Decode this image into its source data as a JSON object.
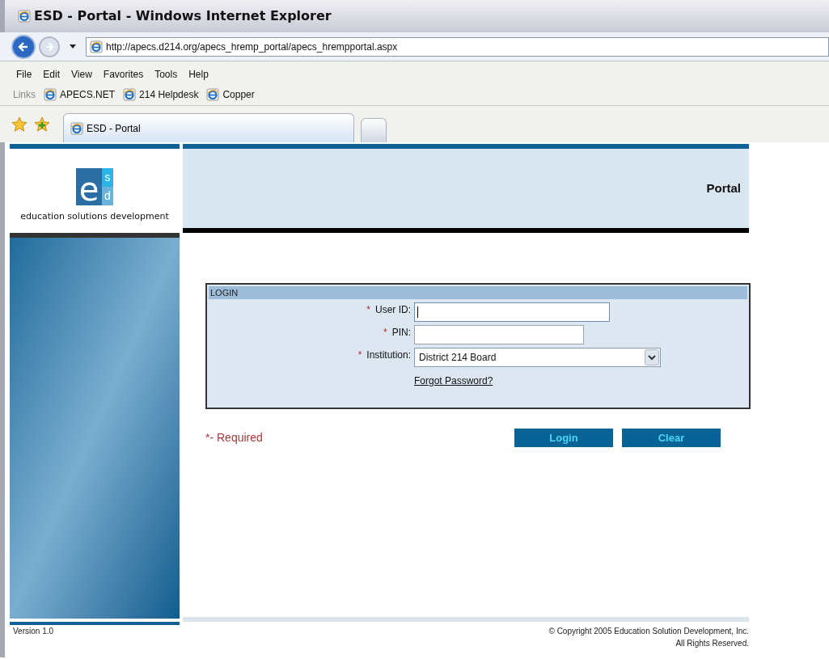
{
  "window": {
    "title": "ESD - Portal - Windows Internet Explorer"
  },
  "address_bar": {
    "url": "http://apecs.d214.org/apecs_hremp_portal/apecs_hrempportal.aspx"
  },
  "menu": [
    {
      "label": "File"
    },
    {
      "label": "Edit"
    },
    {
      "label": "View"
    },
    {
      "label": "Favorites"
    },
    {
      "label": "Tools"
    },
    {
      "label": "Help"
    }
  ],
  "links_bar": {
    "label": "Links",
    "items": [
      "APECS.NET",
      "214 Helpdesk",
      "Copper"
    ]
  },
  "tabs": [
    {
      "label": "ESD - Portal",
      "selected": true
    }
  ],
  "logo": {
    "letters": [
      "e",
      "s",
      "d"
    ],
    "caption": "education solutions development"
  },
  "header": {
    "title": "Portal"
  },
  "login": {
    "title": "LOGIN",
    "fields": [
      {
        "kind": "text",
        "label": "User ID:",
        "required": true,
        "focused": true
      },
      {
        "kind": "password",
        "label": "PIN:",
        "required": true,
        "focused": false
      },
      {
        "kind": "select",
        "label": "Institution:",
        "required": true,
        "value": "District 214 Board"
      }
    ],
    "required_mark": "*",
    "link": "Forgot Password?",
    "legend": "*- Required",
    "buttons": [
      "Login",
      "Clear"
    ]
  },
  "footer": {
    "version": "Version 1.0",
    "copyright": "© Copyright 2005 Education Solution Development, Inc.",
    "rights": "All Rights Reserved."
  }
}
